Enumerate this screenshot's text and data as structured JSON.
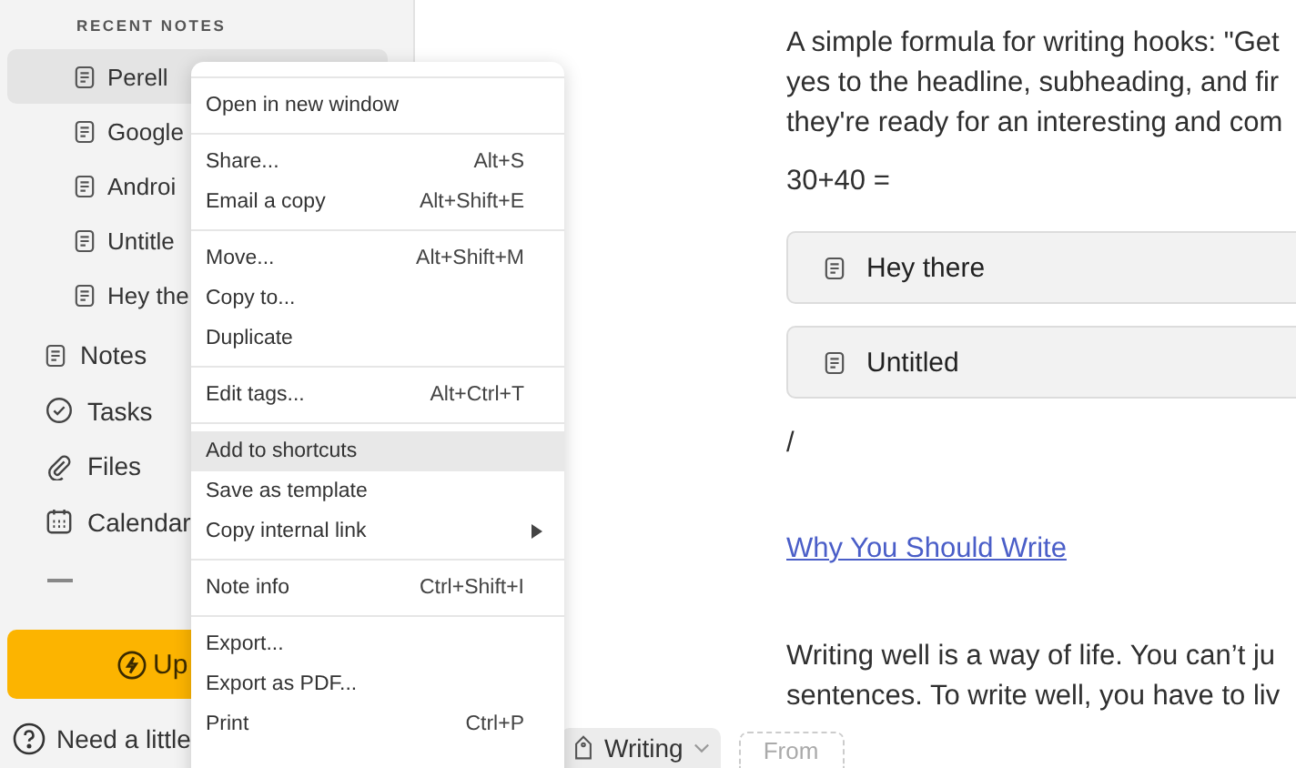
{
  "sidebar": {
    "section_title": "RECENT NOTES",
    "recent_notes": [
      {
        "label": "Perell",
        "selected": true
      },
      {
        "label": "Google",
        "selected": false
      },
      {
        "label": "Androi",
        "selected": false
      },
      {
        "label": "Untitle",
        "selected": false
      },
      {
        "label": "Hey the",
        "selected": false
      }
    ],
    "nav_items": [
      {
        "label": "Notes",
        "kind": "note"
      },
      {
        "label": "Tasks",
        "kind": "task"
      },
      {
        "label": "Files",
        "kind": "file"
      },
      {
        "label": "Calendar",
        "kind": "calendar"
      }
    ],
    "upgrade_button": "Up",
    "help_link": "Need a little"
  },
  "context_menu": {
    "groups": [
      [
        {
          "label": "Open in new window",
          "selected": false
        }
      ],
      [
        {
          "label": "Share...",
          "shortcut": "Alt+S",
          "selected": false
        },
        {
          "label": "Email a copy",
          "shortcut": "Alt+Shift+E",
          "selected": false
        }
      ],
      [
        {
          "label": "Move...",
          "shortcut": "Alt+Shift+M",
          "selected": false
        },
        {
          "label": "Copy to...",
          "selected": false
        },
        {
          "label": "Duplicate",
          "selected": false
        }
      ],
      [
        {
          "label": "Edit tags...",
          "shortcut": "Alt+Ctrl+T",
          "selected": false
        }
      ],
      [
        {
          "label": "Add to shortcuts",
          "selected": true
        },
        {
          "label": "Save as template",
          "selected": false
        },
        {
          "label": "Copy internal link",
          "submenu": true,
          "selected": false
        }
      ],
      [
        {
          "label": "Note info",
          "shortcut": "Ctrl+Shift+I",
          "selected": false
        }
      ],
      [
        {
          "label": "Export...",
          "selected": false
        },
        {
          "label": "Export as PDF...",
          "selected": false
        },
        {
          "label": "Print",
          "shortcut": "Ctrl+P",
          "selected": false
        }
      ]
    ]
  },
  "editor": {
    "paragraph_lines": [
      "A simple formula for writing hooks: \"Get",
      "yes to the headline, subheading, and fir",
      "they're ready for an interesting and com"
    ],
    "equation": "30+40 =",
    "embedded_notes": [
      "Hey there",
      "Untitled"
    ],
    "slash": "/",
    "link": "Why You Should Write",
    "paragraph2_lines": [
      "Writing well is a way of life. You can’t ju",
      "sentences. To write well, you have to liv"
    ],
    "footer": {
      "tag": "Writing",
      "from_field": {
        "placeholder": "From"
      }
    }
  }
}
